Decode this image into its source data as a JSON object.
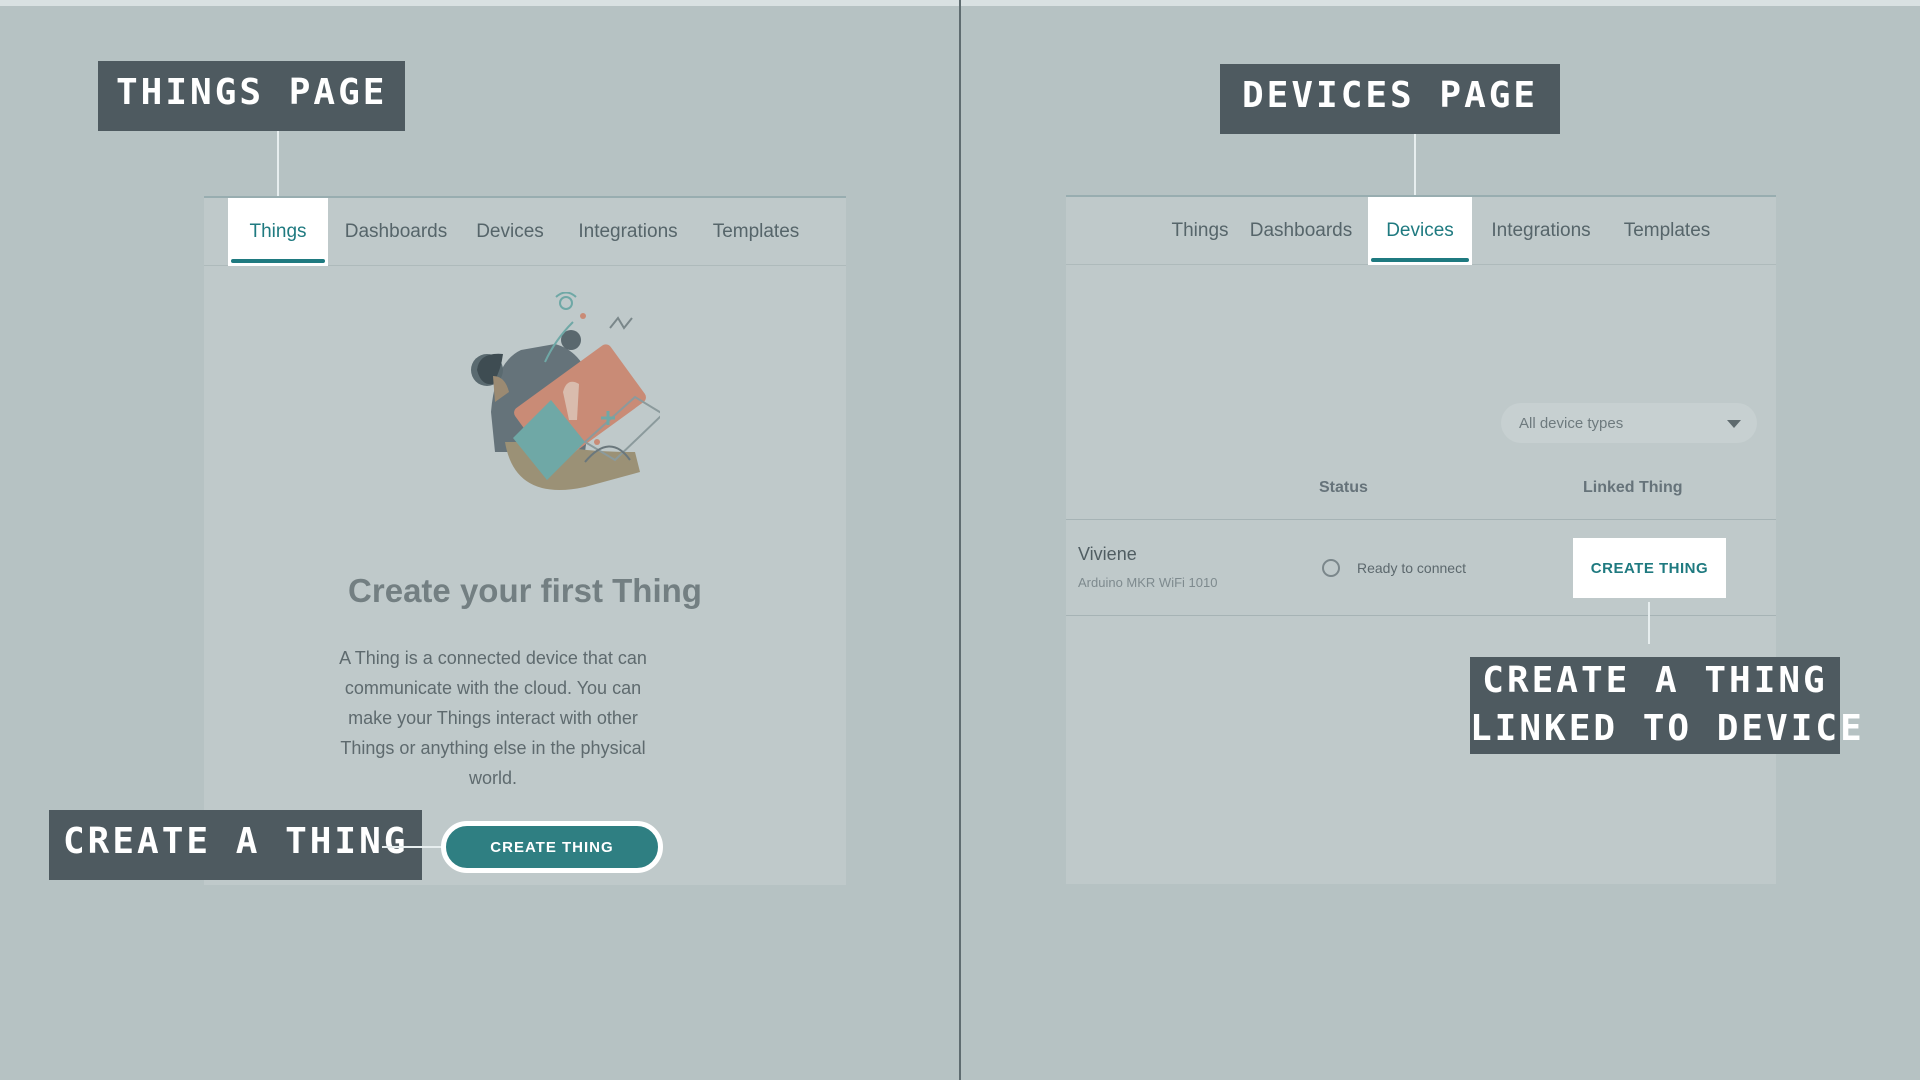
{
  "callouts": {
    "things_page": "THINGS PAGE",
    "devices_page": "DEVICES PAGE",
    "create_thing": "CREATE A THING",
    "create_linked_line1": "CREATE A THING",
    "create_linked_line2": "LINKED TO DEVICE"
  },
  "things_panel": {
    "tabs": [
      "Things",
      "Dashboards",
      "Devices",
      "Integrations",
      "Templates"
    ],
    "active_tab": "Things",
    "title": "Create your first Thing",
    "description": "A Thing is a connected device that can communicate with the cloud. You can make your Things interact with other Things or anything else in the physical world.",
    "button": "CREATE THING"
  },
  "devices_panel": {
    "tabs": [
      "Things",
      "Dashboards",
      "Devices",
      "Integrations",
      "Templates"
    ],
    "active_tab": "Devices",
    "filter": {
      "selected": "All device types"
    },
    "columns": {
      "status": "Status",
      "linked_thing": "Linked Thing"
    },
    "rows": [
      {
        "name": "Viviene",
        "type": "Arduino MKR WiFi 1010",
        "status": "Ready to connect",
        "action": "CREATE THING"
      }
    ]
  },
  "colors": {
    "background": "#b6c2c3",
    "callout_bg": "#4e5a60",
    "accent": "#1f7a80",
    "button_teal": "#2f7f82",
    "illustration_orange": "#c98b76",
    "illustration_teal": "#6fa8a6"
  },
  "icons": [
    "caret-down-icon",
    "status-radio-icon",
    "person-device-illustration"
  ]
}
